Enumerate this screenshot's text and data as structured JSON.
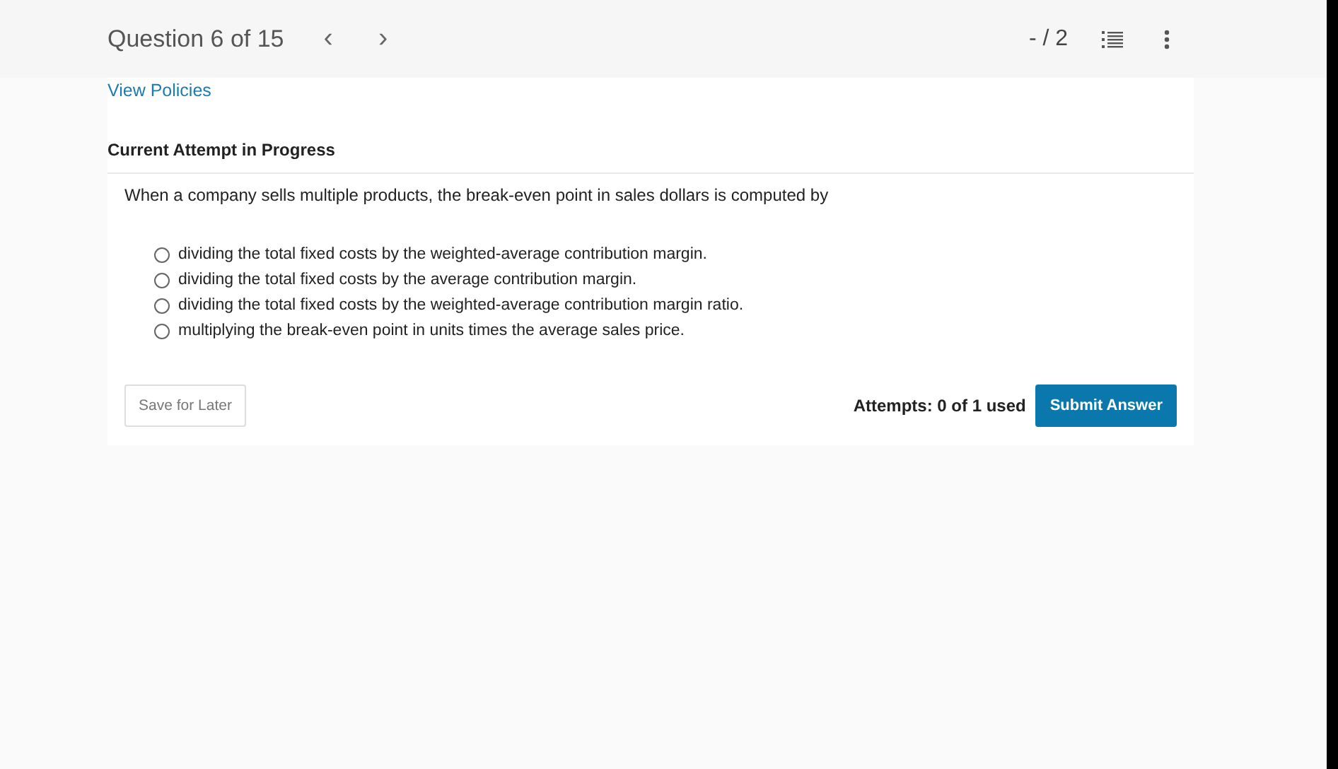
{
  "header": {
    "title": "Question 6 of 15",
    "prev": "‹",
    "next": "›",
    "score": "- / 2"
  },
  "policies_link": "View Policies",
  "status": "Current Attempt in Progress",
  "question": "When a company sells multiple products, the break-even point in sales dollars is computed by",
  "options": [
    {
      "label": "dividing the total fixed costs by the weighted-average contribution margin.",
      "selected": false
    },
    {
      "label": "dividing the total fixed costs by the average contribution margin.",
      "selected": false
    },
    {
      "label": "dividing the total fixed costs by the weighted-average contribution margin ratio.",
      "selected": false
    },
    {
      "label": "multiplying the break-even point in units times the average sales price.",
      "selected": false
    }
  ],
  "save_button": "Save for Later",
  "attempts": "Attempts: 0 of 1 used",
  "submit_button": "Submit Answer"
}
